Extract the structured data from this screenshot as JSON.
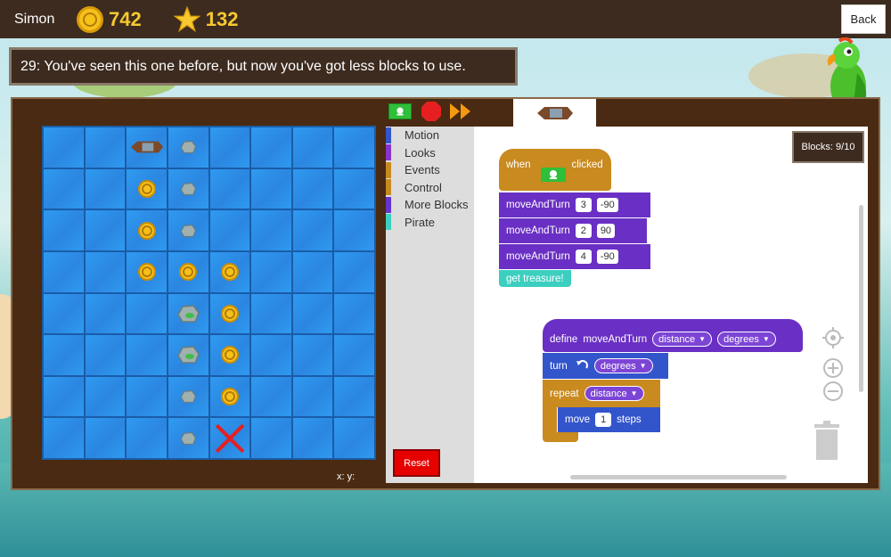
{
  "topbar": {
    "username": "Simon",
    "coins": "742",
    "stars": "132",
    "back_label": "Back"
  },
  "instruction": "29: You've seen this one before, but now you've got less blocks to use.",
  "coords_label": "x: y:",
  "palette": {
    "categories": [
      {
        "label": "Motion",
        "color": "#3355cc"
      },
      {
        "label": "Looks",
        "color": "#8a33cc"
      },
      {
        "label": "Events",
        "color": "#c88a20"
      },
      {
        "label": "Control",
        "color": "#c88a20"
      },
      {
        "label": "More Blocks",
        "color": "#6633cc"
      },
      {
        "label": "Pirate",
        "color": "#3ccfc0"
      }
    ],
    "reset_label": "Reset"
  },
  "blocks_count": "Blocks: 9/10",
  "script1": {
    "when": "when",
    "clicked": "clicked",
    "rows": [
      {
        "label": "moveAndTurn",
        "a": "3",
        "b": "-90"
      },
      {
        "label": "moveAndTurn",
        "a": "2",
        "b": "90"
      },
      {
        "label": "moveAndTurn",
        "a": "4",
        "b": "-90"
      }
    ],
    "treasure": "get treasure!"
  },
  "script2": {
    "define": "define",
    "name": "moveAndTurn",
    "param1": "distance",
    "param2": "degrees",
    "turn": "turn",
    "turn_param": "degrees",
    "repeat": "repeat",
    "repeat_param": "distance",
    "move": "move",
    "move_val": "1",
    "steps": "steps"
  },
  "board": {
    "cols": 8,
    "rows": 8,
    "items": [
      {
        "row": 0,
        "col": 2,
        "kind": "ship"
      },
      {
        "row": 0,
        "col": 3,
        "kind": "rock"
      },
      {
        "row": 1,
        "col": 2,
        "kind": "coin"
      },
      {
        "row": 1,
        "col": 3,
        "kind": "rock"
      },
      {
        "row": 2,
        "col": 2,
        "kind": "coin"
      },
      {
        "row": 2,
        "col": 3,
        "kind": "rock"
      },
      {
        "row": 3,
        "col": 2,
        "kind": "coin"
      },
      {
        "row": 3,
        "col": 3,
        "kind": "coin"
      },
      {
        "row": 3,
        "col": 4,
        "kind": "coin"
      },
      {
        "row": 4,
        "col": 3,
        "kind": "rock-big"
      },
      {
        "row": 4,
        "col": 4,
        "kind": "coin"
      },
      {
        "row": 5,
        "col": 3,
        "kind": "rock-big"
      },
      {
        "row": 5,
        "col": 4,
        "kind": "coin"
      },
      {
        "row": 6,
        "col": 3,
        "kind": "rock"
      },
      {
        "row": 6,
        "col": 4,
        "kind": "coin"
      },
      {
        "row": 7,
        "col": 3,
        "kind": "rock"
      },
      {
        "row": 7,
        "col": 4,
        "kind": "x-mark"
      }
    ]
  },
  "colors": {
    "motion": "#3355cc",
    "events": "#c88a20",
    "more_blocks": "#6a2fc4",
    "pirate": "#3ccfc0",
    "reset": "#e60000"
  }
}
